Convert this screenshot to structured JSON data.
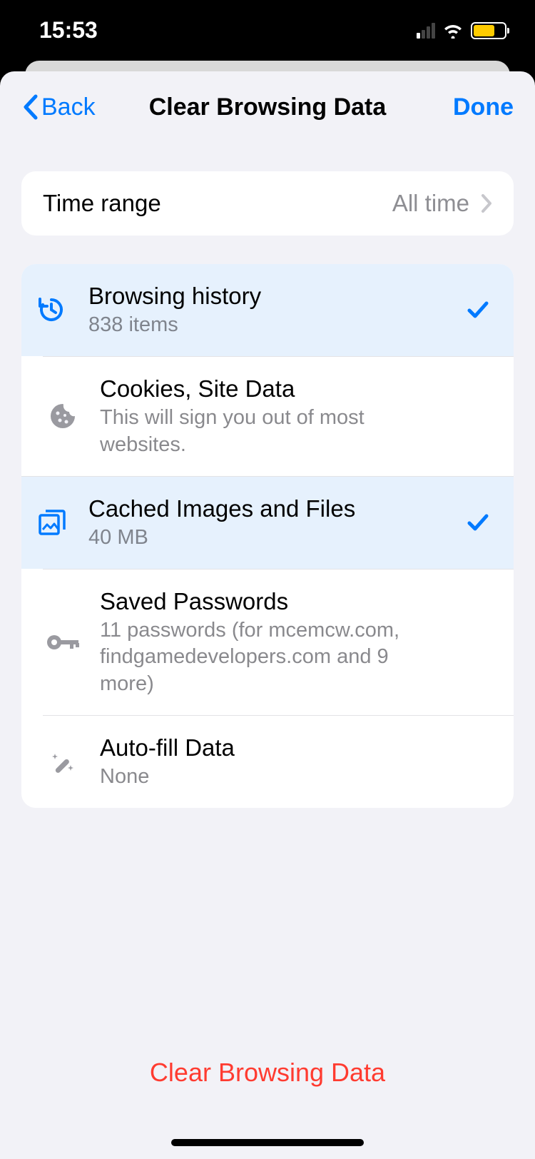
{
  "status": {
    "time": "15:53"
  },
  "nav": {
    "back": "Back",
    "title": "Clear Browsing Data",
    "done": "Done"
  },
  "timeRange": {
    "label": "Time range",
    "value": "All time"
  },
  "items": [
    {
      "title": "Browsing history",
      "subtitle": "838 items",
      "selected": true
    },
    {
      "title": "Cookies, Site Data",
      "subtitle": "This will sign you out of most websites.",
      "selected": false
    },
    {
      "title": "Cached Images and Files",
      "subtitle": "40 MB",
      "selected": true
    },
    {
      "title": "Saved Passwords",
      "subtitle": "11 passwords (for mcemcw.com, findgamedevelopers.com and 9 more)",
      "selected": false
    },
    {
      "title": "Auto-fill Data",
      "subtitle": "None",
      "selected": false
    }
  ],
  "clearButton": "Clear Browsing Data"
}
